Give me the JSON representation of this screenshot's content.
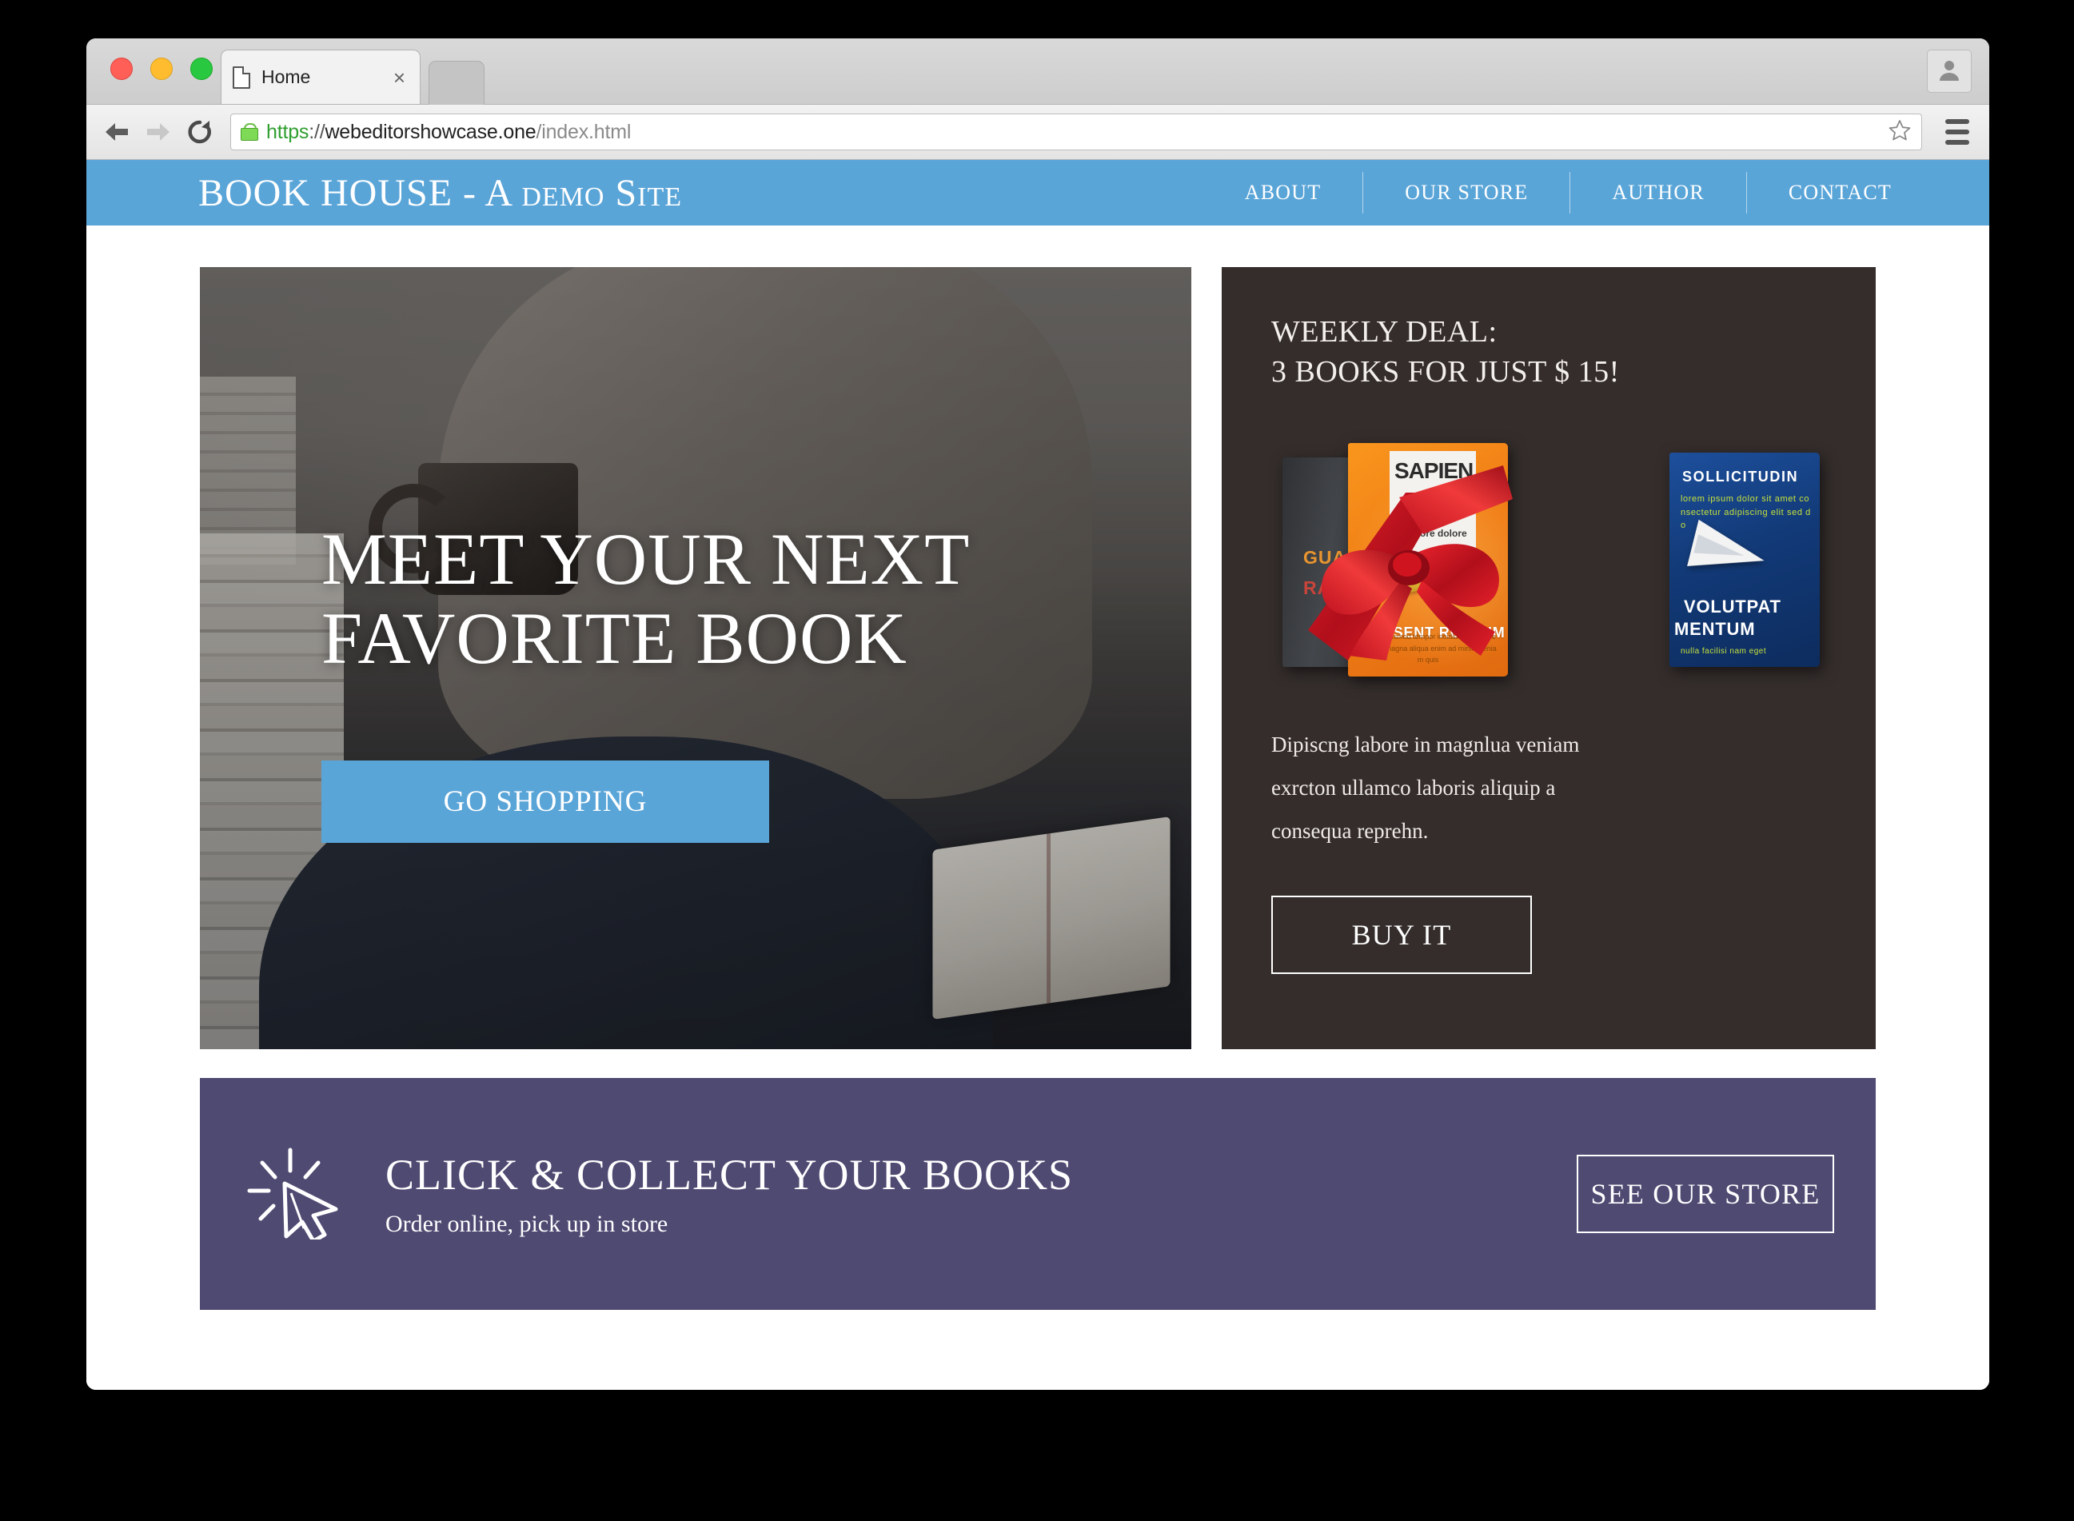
{
  "browser": {
    "tab": {
      "title": "Home",
      "close_label": "×"
    },
    "url": {
      "scheme": "https",
      "separator": "://",
      "host": "webeditorshowcase.one",
      "path": "/index.html"
    },
    "icons": {
      "back": "back-arrow-icon",
      "forward": "forward-arrow-icon",
      "reload": "reload-icon",
      "lock": "lock-icon",
      "bookmark": "star-icon",
      "menu": "hamburger-menu-icon",
      "profile": "profile-avatar-icon",
      "page": "page-icon",
      "new_tab": "new-tab-button"
    }
  },
  "site": {
    "title": "BOOK HOUSE - A demo Site",
    "accent_blue": "#5aa5d8",
    "dark_panel": "#342d2c",
    "purple_banner": "#4f4a72",
    "nav": [
      {
        "label": "ABOUT"
      },
      {
        "label": "OUR STORE"
      },
      {
        "label": "AUTHOR"
      },
      {
        "label": "CONTACT"
      }
    ]
  },
  "hero": {
    "title_line1": "MEET YOUR NEXT",
    "title_line2": "FAVORITE BOOK",
    "cta_label": "GO SHOPPING",
    "image_alt": "person-reading-book-with-mug-photo"
  },
  "deal": {
    "heading_line1": "WEEKLY DEAL:",
    "heading_line2": "3 BOOKS FOR JUST $ 15!",
    "body": "Dipiscng labore in magnlua veniam exrcton ullamco laboris aliquip a consequa reprehn.",
    "button_label": "BUY IT",
    "books": {
      "gray": {
        "title_a": "GUAS",
        "amp": "&",
        "title_b": "RA"
      },
      "orange": {
        "overlay_title": "SAPIEN",
        "overlay_line": "ut labore dolore",
        "title": "PRAESENT RUTRUM",
        "subtitle": "sed do eiusmod tempor incididunt labore et dolore magna aliqua enim ad minim veniam quis"
      },
      "blue": {
        "top": "SOLLICITUDIN",
        "top_sub": "lorem ipsum dolor sit amet consectetur adipiscing elit sed do",
        "bottom_1": "VOLUTPAT",
        "bottom_2": "MENTUM",
        "bottom_sub": "nulla facilisi nam eget"
      }
    }
  },
  "banner": {
    "icon": "click-cursor-icon",
    "title": "CLICK & COLLECT YOUR BOOKS",
    "subtitle": "Order online, pick up in store",
    "button_label": "SEE OUR STORE"
  }
}
